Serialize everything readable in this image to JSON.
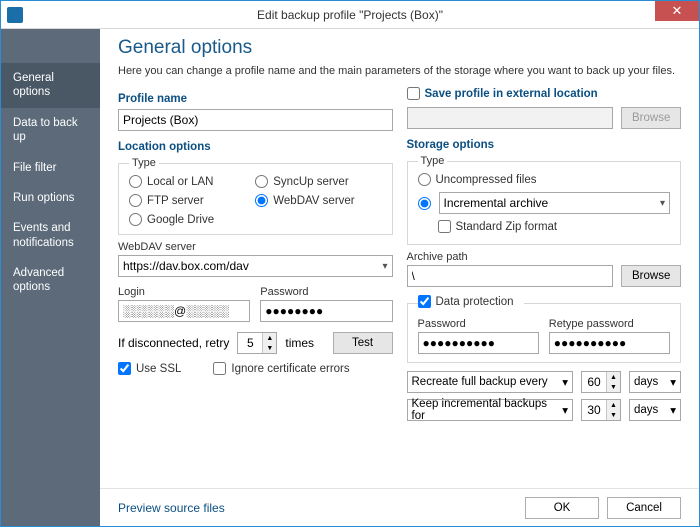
{
  "window": {
    "title": "Edit backup profile \"Projects (Box)\"",
    "close_glyph": "✕"
  },
  "sidebar": {
    "items": [
      {
        "label": "General options",
        "active": true
      },
      {
        "label": "Data to back up",
        "active": false
      },
      {
        "label": "File filter",
        "active": false
      },
      {
        "label": "Run options",
        "active": false
      },
      {
        "label": "Events and notifications",
        "active": false
      },
      {
        "label": "Advanced options",
        "active": false
      }
    ]
  },
  "header": {
    "title": "General options",
    "desc": "Here you can change a profile name and the main parameters of the storage where you want to back up your files."
  },
  "left": {
    "profile_name_label": "Profile name",
    "profile_name_value": "Projects (Box)",
    "location_options_label": "Location options",
    "type_legend": "Type",
    "radios": {
      "local": "Local or LAN",
      "syncup": "SyncUp server",
      "ftp": "FTP server",
      "webdav": "WebDAV server",
      "gdrive": "Google Drive",
      "selected": "webdav"
    },
    "webdav_label": "WebDAV server",
    "webdav_value": "https://dav.box.com/dav",
    "login_label": "Login",
    "login_value": "░░░░░░@░░░░░",
    "password_label": "Password",
    "password_value": "●●●●●●●●",
    "retry_prefix": "If disconnected, retry",
    "retry_value": "5",
    "retry_suffix": "times",
    "test_label": "Test",
    "use_ssl_label": "Use SSL",
    "use_ssl_checked": true,
    "ignore_cert_label": "Ignore certificate errors",
    "ignore_cert_checked": false
  },
  "right": {
    "save_profile_label": "Save profile in external location",
    "save_profile_checked": false,
    "browse_label": "Browse",
    "storage_options_label": "Storage options",
    "type_legend": "Type",
    "uncompressed_label": "Uncompressed files",
    "incremental_label": "Incremental archive",
    "type_selected": "incremental",
    "standard_zip_label": "Standard Zip format",
    "standard_zip_checked": false,
    "archive_path_label": "Archive path",
    "archive_path_value": "\\",
    "data_protection_label": "Data protection",
    "data_protection_checked": true,
    "dp_password_label": "Password",
    "dp_password_value": "●●●●●●●●●●",
    "dp_retype_label": "Retype password",
    "dp_retype_value": "●●●●●●●●●●",
    "recreate_label": "Recreate full backup every",
    "recreate_value": "60",
    "recreate_unit": "days",
    "keep_label": "Keep incremental backups for",
    "keep_value": "30",
    "keep_unit": "days"
  },
  "footer": {
    "preview_label": "Preview source files",
    "ok_label": "OK",
    "cancel_label": "Cancel"
  }
}
